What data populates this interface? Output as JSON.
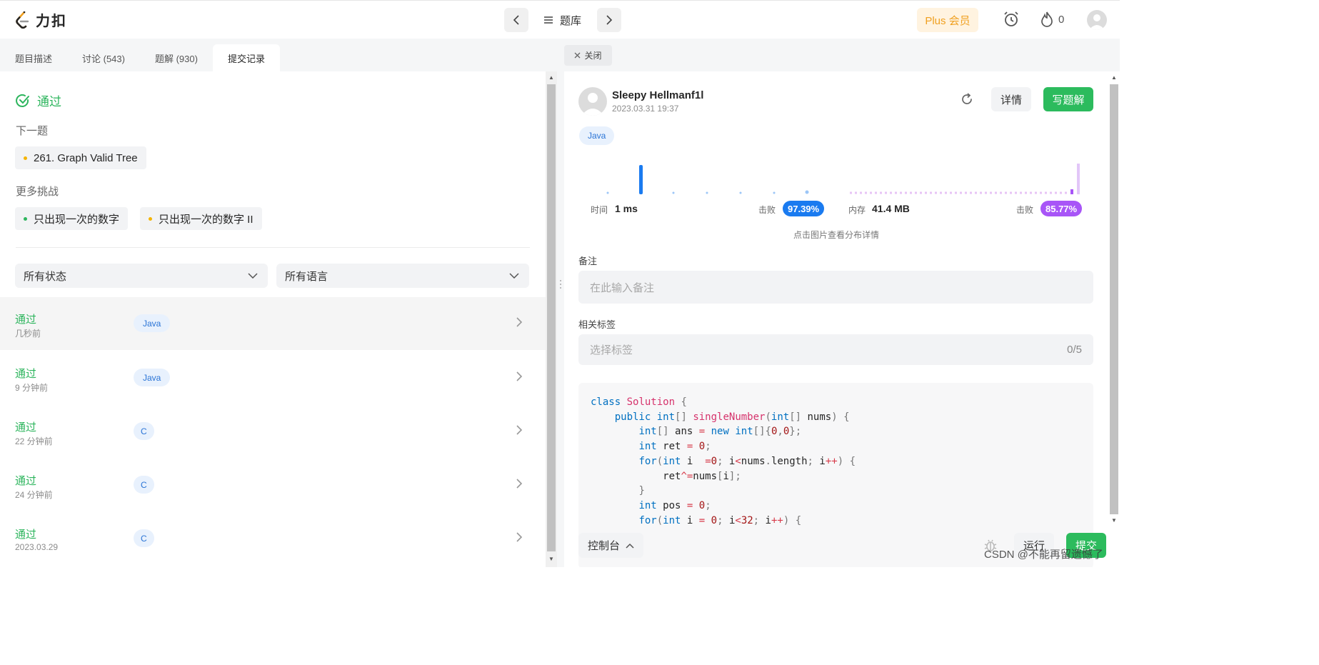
{
  "header": {
    "logo_text": "力扣",
    "problem_lib": "题库",
    "plus_label": "Plus 会员",
    "streak_count": "0"
  },
  "tabs": [
    {
      "label": "题目描述"
    },
    {
      "label": "讨论 (543)"
    },
    {
      "label": "题解 (930)"
    },
    {
      "label": "提交记录"
    }
  ],
  "left": {
    "status": "通过",
    "next_label": "下一题",
    "next_problem": "261. Graph Valid Tree",
    "more_label": "更多挑战",
    "challenges": [
      {
        "title": "只出现一次的数字",
        "dot": "#2db55d"
      },
      {
        "title": "只出现一次的数字 II",
        "dot": "#f5b400"
      }
    ],
    "filter_status": "所有状态",
    "filter_lang": "所有语言",
    "submissions": [
      {
        "status": "通过",
        "time": "几秒前",
        "lang": "Java"
      },
      {
        "status": "通过",
        "time": "9 分钟前",
        "lang": "Java"
      },
      {
        "status": "通过",
        "time": "22 分钟前",
        "lang": "C"
      },
      {
        "status": "通过",
        "time": "24 分钟前",
        "lang": "C"
      },
      {
        "status": "通过",
        "time": "2023.03.29",
        "lang": "C"
      }
    ]
  },
  "right": {
    "close_label": "关闭",
    "user_name": "Sleepy Hellmanf1l",
    "date": "2023.03.31 19:37",
    "detail_label": "详情",
    "write_label": "写题解",
    "lang_tag": "Java",
    "time_label": "时间",
    "time_value": "1 ms",
    "beat_label": "击败",
    "time_beat": "97.39%",
    "mem_label": "内存",
    "mem_value": "41.4 MB",
    "mem_beat": "85.77%",
    "hint": "点击图片查看分布详情",
    "note_label": "备注",
    "note_placeholder": "在此输入备注",
    "tags_label": "相关标签",
    "tags_placeholder": "选择标签",
    "tags_count": "0/5",
    "colors": {
      "time_beat": "#1a7bf0",
      "mem_beat": "#a855f7",
      "accent_green": "#2cbb5d"
    }
  },
  "bottom": {
    "console_label": "控制台",
    "run_label": "运行",
    "submit_label": "提交",
    "watermark": "CSDN @不能再留遗憾了"
  }
}
